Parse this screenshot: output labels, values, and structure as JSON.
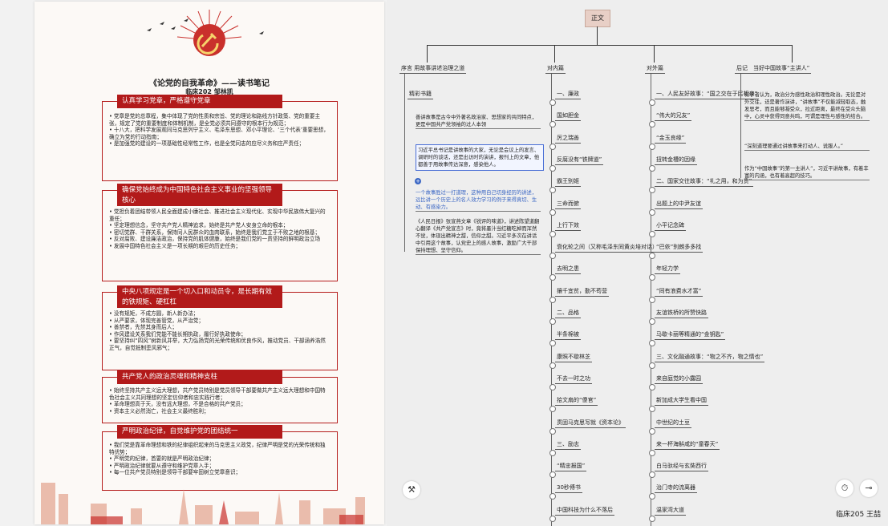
{
  "note": {
    "title": "《论党的自我革命》——读书笔记",
    "author": "临床202 邹林凯",
    "sections": [
      {
        "heading": "认真学习党章，严格遵守党章",
        "items": [
          "党章是党的总章程，集中体现了党的性质和宗旨、党的理论和路线方针政策、党的重要主张，规定了党的重要制度和体制机制，是全党必须共同遵守的根本行为规范；",
          "十八大，把科学发展观同马克思列宁主义、毛泽东思想、邓小平理论、‘三个代表’重要思想，确立为党的行动指南；",
          "是加强党的建设的一项基础性经常性工作，也是全党同志的应尽义务和庄严责任；"
        ]
      },
      {
        "heading": "确保党始终成为中国特色社会主义事业的坚强领导核心",
        "items": [
          "党担负着团结带领人民全面建成小康社会、推进社会主义现代化、实现中华民族伟大复兴的重任；",
          "坚定理想信念，坚守共产党人精神追求，始终是共产党人安身立命的根本；",
          "密切党群、干群关系，保持同人民群众的血肉联系，始终是我们党立于不败之地的根基；",
          "反对腐败、建设廉洁政治，保持党的肌体健康，始终是我们党的一贯坚持的鲜明政治立场",
          "发展中国特色社会主义是一项长期的艰巨的历史任务；"
        ]
      },
      {
        "heading": "中央八项规定是一个切入口和动员令，是长期有效的铁规矩、硬杠杠",
        "items": [
          "没有规矩，不成方圆，新人新办法；",
          "从严要求，体现完善管党，从严治党；",
          "善禁者，先禁其身而后人；",
          "作风建设关系我们党能不能长期执政，履行好执政使命；",
          "要坚持纠“四风”树新风并举，大力弘扬党的光荣传统和优良作风，推动党员、干部涵养浩然正气，自觉抵制歪风邪气；"
        ]
      },
      {
        "heading": "共产党人的政治灵魂和精神支柱",
        "items": [
          "始终坚持共产主义远大理想，共产党员特别是党员领导干部要做共产主义远大理想和中国特色社会主义共同理想的坚定信仰者和忠实践行者；",
          "革命理想高于天，没有远大理想，不是合格的共产党员；",
          "资本主义必然消亡，社会主义最终胜利；"
        ]
      },
      {
        "heading": "严明政治纪律，自觉维护党的团结统一",
        "items": [
          "我们党是靠革命理想和铁的纪律组织起来的马克思主义政党，纪律严明是党的光荣传统和独特优势；",
          "严明党的纪律，首要的就是严明政治纪律；",
          "严明政治纪律就要从遵守和维护党章入手；",
          "每一位共产党员特别是领导干部要牢固树立党章意识；"
        ]
      }
    ]
  },
  "mindmap": {
    "root": "正文",
    "branches": [
      {
        "title": "序言 用故事讲述治理之道",
        "children": [
          "精彩书籍",
          "善讲故事是古今中外著名政治家、思想家的共同特点，更是中国共产党领袖的过人本领",
          "习近平总书记是讲故事的大家，无论是会议上的发言、调研时的谈话，还是出访时的演讲，报刊上的文章，他都善于用故事传达深意，感染他人。",
          "一个故事胜过一打道理，这种用自己切身经历的讲述，远比讲一个历史上的名人效力学习的例子来得真切、生动、有感染力。",
          "《人民日报》张宣燕文章《锐评的味道》，讲述陈望道翻心翻译《共产党宣言》时，竟将墨汁当红糖吃掉而浑然不觉，体现出精神之甜，信仰之甜。习近平多次在讲话中引用这个故事，认党史上的感人故事，激励广大干部保持理想、坚守信仰。"
        ]
      },
      {
        "title": "对内篇",
        "children": [
          "一、廉政",
          "国如胆金",
          "厉之瑞善",
          "反腐没有“铁牌道”",
          "霸王别姬",
          "三命而俯",
          "上行下效",
          "衰化轮之间（又称毛泽东同黄炎培对话）",
          "去明之患",
          "攘千宜贫，勤不苟营",
          "二、品格",
          "半条棉被",
          "康照不歇林芝",
          "不去一时之功",
          "拾文扇的“傻官”",
          "贯固马克思写就《资本论》",
          "三、励志",
          "“精忠报国”",
          "30秒傅书",
          "中国科技为什么不落后"
        ]
      },
      {
        "title": "对外篇",
        "children": [
          "一、人民友好故事：“国之交在于民相亲”",
          "“伟大的兄友”",
          "“金玉良缘”",
          "扭转金槽的因缘",
          "二、国家交往故事：“礼之用，和为贵”",
          "出题上的中尹友谊",
          "小平记念碑",
          "“巴依”别朗多多找",
          "年轻力学",
          "“同有浪费水才富”",
          "友谊铁桥的所赞快路",
          "马歇卡丽等精通的“金钥匙”",
          "三、文化融通故事：“物之不齐，物之情也”",
          "来自庭觉的小露园",
          "新加成大学生看中国",
          "中世纪的土豆",
          "来一杯海斛咸的“童春天”",
          "白马驮经与玄奘西行",
          "治门寺的流离器",
          "温家湾大道"
        ]
      },
      {
        "title": "后记　当好中国故事“主讲人”",
        "children": [
          "有学者认为，政治分为感性政治和理性政治。无论是对外交往，还是著作演讲，“讲故事”不仅能减轻取态，触发思考，而且能够凝受众，拉近距离，最终在受众头脑中，心灵中获得同意共鸣，可谓是理性与感性的结合。",
          "“深刻道理要通过讲故事来打动人、说服人。”",
          "作为“中国故事”的第一主讲人”，习近平讲故事，有着丰富的内涵，也有着高超的技巧。"
        ]
      }
    ],
    "signature": "临床205 王喆"
  }
}
